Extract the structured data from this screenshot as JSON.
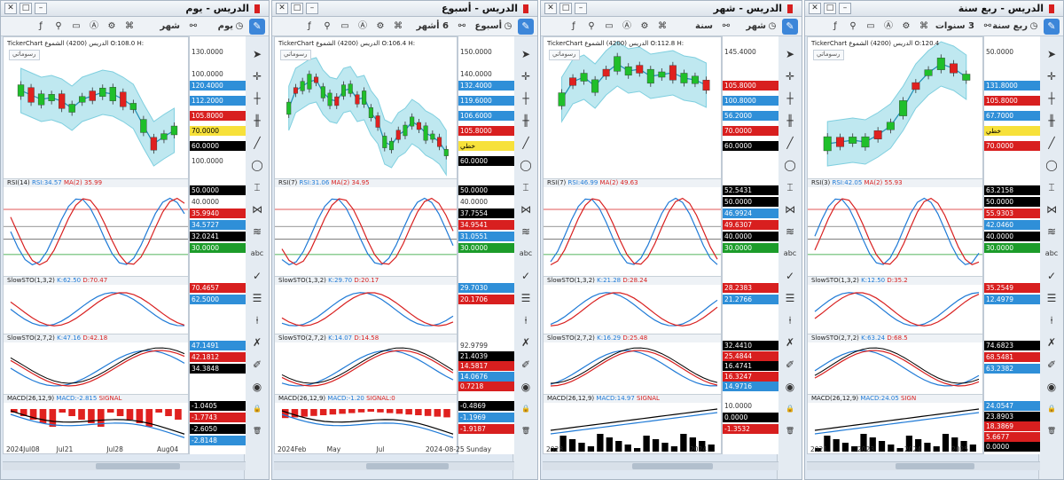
{
  "panels": [
    {
      "title": "الدريس - يوم",
      "toolbar": {
        "timeframe": "يوم",
        "range": "شهر"
      },
      "chart_name": "TickerChart  الدريس (4200)  الشموع  O:108.0  H:",
      "drawing_label": "رسوماتي",
      "axis_ticks": [
        "130.0000",
        "100.0000"
      ],
      "price_labels": [
        {
          "text": "120.4000",
          "style": "blue"
        },
        {
          "text": "112.2000",
          "style": "blue"
        },
        {
          "text": "105.8000",
          "style": "red"
        },
        {
          "text": "70.0000",
          "style": "yellow"
        },
        {
          "text": "60.0000",
          "style": "black"
        },
        {
          "text": "100.0000",
          "style": "text"
        }
      ],
      "indicators": [
        {
          "header": "RSI(14)",
          "v1": "RSI:34.57",
          "v2": "MA(2)",
          "v3": "35.99",
          "labels": [
            {
              "text": "50.0000",
              "style": "black"
            },
            {
              "text": "40.0000",
              "style": "text"
            },
            {
              "text": "35.9940",
              "style": "red"
            },
            {
              "text": "34.5727",
              "style": "blue"
            },
            {
              "text": "32.0241",
              "style": "black"
            },
            {
              "text": "30.0000",
              "style": "green"
            }
          ]
        },
        {
          "header": "SlowSTO(1,3,2)",
          "v1": "K:62.50",
          "v2": "D:70.47",
          "v3": "",
          "labels": [
            {
              "text": "70.4657",
              "style": "red"
            },
            {
              "text": "62.5000",
              "style": "blue"
            }
          ]
        },
        {
          "header": "SlowSTO(2,7,2)",
          "v1": "K:47.16",
          "v2": "D:42.18",
          "v3": "",
          "labels": [
            {
              "text": "47.1491",
              "style": "blue"
            },
            {
              "text": "42.1812",
              "style": "red"
            },
            {
              "text": "34.3848",
              "style": "black"
            }
          ]
        },
        {
          "header": "MACD(26,12,9)",
          "v1": "MACD:-2.815",
          "v2": "SIGNAL",
          "v3": "",
          "labels": [
            {
              "text": "-1.0405",
              "style": "black"
            },
            {
              "text": "-1.7743",
              "style": "red"
            },
            {
              "text": "-2.6050",
              "style": "black"
            },
            {
              "text": "-2.8148",
              "style": "blue"
            }
          ]
        }
      ],
      "x_labels": [
        "2024Jul08",
        "Jul21",
        "Jul28",
        "Aug04"
      ]
    },
    {
      "title": "الدريس - أسبوع",
      "toolbar": {
        "timeframe": "أسبوع",
        "range": "6 أشهر"
      },
      "chart_name": "TickerChart  الدريس (4200)  الشموع  O:106.4  H:",
      "drawing_label": "رسوماتي",
      "axis_ticks": [
        "150.0000",
        "140.0000"
      ],
      "price_labels": [
        {
          "text": "132.4000",
          "style": "blue"
        },
        {
          "text": "119.6000",
          "style": "blue"
        },
        {
          "text": "106.6000",
          "style": "blue"
        },
        {
          "text": "105.8000",
          "style": "red"
        },
        {
          "text": "خطي",
          "style": "yellow"
        },
        {
          "text": "60.0000",
          "style": "black"
        }
      ],
      "indicators": [
        {
          "header": "RSI(7)",
          "v1": "RSI:31.06",
          "v2": "MA(2)",
          "v3": "34.95",
          "labels": [
            {
              "text": "50.0000",
              "style": "black"
            },
            {
              "text": "40.0000",
              "style": "text"
            },
            {
              "text": "37.7554",
              "style": "black"
            },
            {
              "text": "34.9541",
              "style": "red"
            },
            {
              "text": "31.0551",
              "style": "blue"
            },
            {
              "text": "30.0000",
              "style": "green"
            }
          ]
        },
        {
          "header": "SlowSTO(1,3,2)",
          "v1": "K:29.70",
          "v2": "D:20.17",
          "v3": "",
          "labels": [
            {
              "text": "29.7030",
              "style": "blue"
            },
            {
              "text": "20.1706",
              "style": "red"
            }
          ]
        },
        {
          "header": "SlowSTO(2,7,2)",
          "v1": "K:14.07",
          "v2": "D:14.58",
          "v3": "",
          "labels": [
            {
              "text": "92.9799",
              "style": "text"
            },
            {
              "text": "21.4039",
              "style": "black"
            },
            {
              "text": "14.5817",
              "style": "red"
            },
            {
              "text": "14.0676",
              "style": "blue"
            },
            {
              "text": "0.7218",
              "style": "red"
            }
          ]
        },
        {
          "header": "MACD(26,12,9)",
          "v1": "MACD:-1.20",
          "v2": "SIGNAL:0",
          "v3": "",
          "labels": [
            {
              "text": "-0.4869",
              "style": "black"
            },
            {
              "text": "-1.1969",
              "style": "blue"
            },
            {
              "text": "-1.9187",
              "style": "red"
            }
          ]
        }
      ],
      "x_labels": [
        "2024Feb",
        "May",
        "Jul",
        "2024-08-25 Sunday"
      ]
    },
    {
      "title": "الدريس - شهر",
      "toolbar": {
        "timeframe": "شهر",
        "range": "سنة"
      },
      "chart_name": "TickerChart  الدريس (4200)  الشموع  O:112.8  H:",
      "drawing_label": "رسوماتي",
      "axis_ticks": [
        "145.4000"
      ],
      "price_labels": [
        {
          "text": "105.8000",
          "style": "red"
        },
        {
          "text": "100.8000",
          "style": "blue"
        },
        {
          "text": "56.2000",
          "style": "blue"
        },
        {
          "text": "70.0000",
          "style": "red"
        },
        {
          "text": "60.0000",
          "style": "black"
        }
      ],
      "indicators": [
        {
          "header": "RSI(7)",
          "v1": "RSI:46.99",
          "v2": "MA(2)",
          "v3": "49.63",
          "labels": [
            {
              "text": "52.5431",
              "style": "black"
            },
            {
              "text": "50.0000",
              "style": "black"
            },
            {
              "text": "46.9924",
              "style": "blue"
            },
            {
              "text": "49.6307",
              "style": "red"
            },
            {
              "text": "40.0000",
              "style": "black"
            },
            {
              "text": "30.0000",
              "style": "green"
            }
          ]
        },
        {
          "header": "SlowSTO(1,3,2)",
          "v1": "K:21.28",
          "v2": "D:28.24",
          "v3": "",
          "labels": [
            {
              "text": "28.2383",
              "style": "red"
            },
            {
              "text": "21.2766",
              "style": "blue"
            }
          ]
        },
        {
          "header": "SlowSTO(2,7,2)",
          "v1": "K:16.29",
          "v2": "D:25.48",
          "v3": "",
          "labels": [
            {
              "text": "32.4410",
              "style": "black"
            },
            {
              "text": "25.4844",
              "style": "red"
            },
            {
              "text": "16.4741",
              "style": "black"
            },
            {
              "text": "16.3247",
              "style": "red"
            },
            {
              "text": "14.9716",
              "style": "blue"
            }
          ]
        },
        {
          "header": "MACD(26,12,9)",
          "v1": "MACD:14.97",
          "v2": "SIGNAL",
          "v3": "",
          "labels": [
            {
              "text": "10.0000",
              "style": "text"
            },
            {
              "text": "0.0000",
              "style": "black"
            },
            {
              "text": "-1.3532",
              "style": "red"
            }
          ]
        }
      ],
      "x_labels": [
        "2023",
        "2024"
      ]
    },
    {
      "title": "الدريس - ربع سنة",
      "toolbar": {
        "timeframe": "ربع سنة",
        "range": "3 سنوات"
      },
      "chart_name": "TickerChart  الدريس (4200)  الشموع  O:120.4",
      "drawing_label": "رسوماتي",
      "axis_ticks": [
        "50.0000"
      ],
      "price_labels": [
        {
          "text": "131.8000",
          "style": "blue"
        },
        {
          "text": "105.8000",
          "style": "red"
        },
        {
          "text": "67.7000",
          "style": "blue"
        },
        {
          "text": "خطي",
          "style": "yellow"
        },
        {
          "text": "70.0000",
          "style": "red"
        }
      ],
      "indicators": [
        {
          "header": "RSI(3)",
          "v1": "RSI:42.05",
          "v2": "MA(2)",
          "v3": "55.93",
          "labels": [
            {
              "text": "63.2158",
              "style": "black"
            },
            {
              "text": "50.0000",
              "style": "black"
            },
            {
              "text": "55.9303",
              "style": "red"
            },
            {
              "text": "42.0460",
              "style": "blue"
            },
            {
              "text": "40.0000",
              "style": "black"
            },
            {
              "text": "30.0000",
              "style": "green"
            }
          ]
        },
        {
          "header": "SlowSTO(1,3,2)",
          "v1": "K:12.50",
          "v2": "D:35.2",
          "v3": "",
          "labels": [
            {
              "text": "35.2549",
              "style": "red"
            },
            {
              "text": "12.4979",
              "style": "blue"
            }
          ]
        },
        {
          "header": "SlowSTO(2,7,2)",
          "v1": "K:63.24",
          "v2": "D:68.5",
          "v3": "",
          "labels": [
            {
              "text": "74.6823",
              "style": "black"
            },
            {
              "text": "68.5481",
              "style": "red"
            },
            {
              "text": "63.2382",
              "style": "blue"
            }
          ]
        },
        {
          "header": "MACD(26,12,9)",
          "v1": "MACD:24.05",
          "v2": "SIGN",
          "v3": "",
          "labels": [
            {
              "text": "24.0547",
              "style": "blue"
            },
            {
              "text": "23.8903",
              "style": "black"
            },
            {
              "text": "18.3869",
              "style": "red"
            },
            {
              "text": "5.6677",
              "style": "red"
            },
            {
              "text": "0.0000",
              "style": "black"
            }
          ]
        }
      ],
      "x_labels": [
        "2021",
        "2023",
        "2024",
        "2025"
      ]
    }
  ],
  "colors": {
    "up": "#1fbf2a",
    "down": "#e0211f",
    "band": "#bfe8f0",
    "rsi": "#1f7ad6",
    "ma": "#d81f1f",
    "accent": "#3c86d9"
  },
  "icons": [
    "pencil-icon",
    "cursor-icon",
    "crosshair-icon",
    "line-icon",
    "shapes-icon",
    "text-icon",
    "eye-icon",
    "lock-icon",
    "trash-icon"
  ]
}
